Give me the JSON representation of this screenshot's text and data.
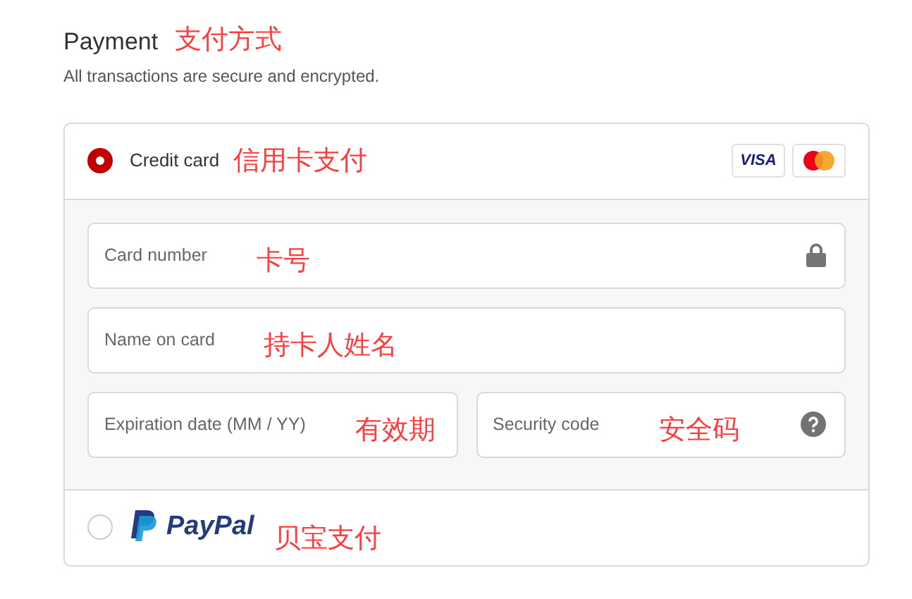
{
  "header": {
    "title": "Payment",
    "annotation": "支付方式",
    "subtitle": "All transactions are secure and encrypted."
  },
  "methods": [
    {
      "kind": "card",
      "label": "Credit card",
      "annotation": "信用卡支付",
      "selected": true,
      "logos": [
        {
          "kind": "visa",
          "text": "VISA"
        },
        {
          "kind": "mastercard"
        }
      ],
      "fields": [
        [
          {
            "kind": "secure",
            "placeholder": "Card number",
            "annotation": "卡号"
          }
        ],
        [
          {
            "kind": "plain",
            "placeholder": "Name on card",
            "annotation": "持卡人姓名"
          }
        ],
        [
          {
            "kind": "plain",
            "placeholder": "Expiration date (MM / YY)",
            "annotation": "有效期"
          },
          {
            "kind": "help",
            "placeholder": "Security code",
            "annotation": "安全码"
          }
        ]
      ]
    },
    {
      "kind": "paypal",
      "label": "PayPal",
      "annotation": "贝宝支付",
      "selected": false
    }
  ]
}
